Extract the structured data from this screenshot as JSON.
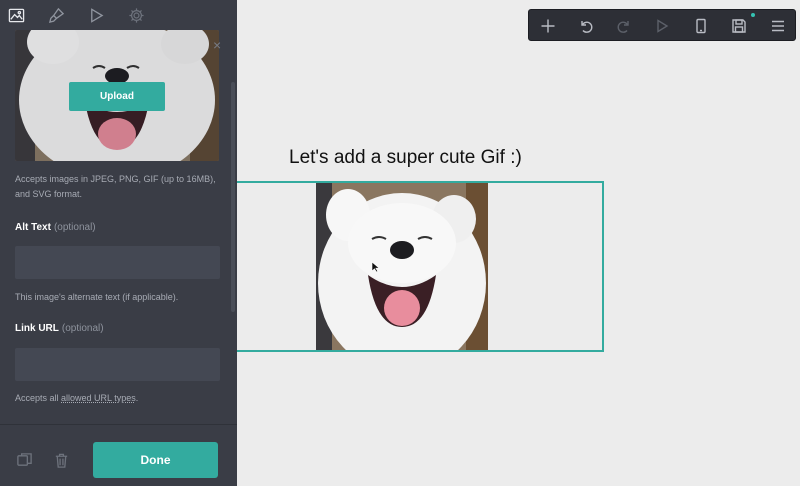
{
  "sidebar": {
    "tabs": [
      {
        "name": "image",
        "icon": "image-icon"
      },
      {
        "name": "style",
        "icon": "brush-icon"
      },
      {
        "name": "animation",
        "icon": "play-icon"
      },
      {
        "name": "settings",
        "icon": "gear-icon"
      }
    ],
    "upload_label": "Upload",
    "accepts_help": "Accepts images in JPEG, PNG, GIF (up to 16MB), and SVG format.",
    "alt_text": {
      "label": "Alt Text",
      "optional": "(optional)",
      "value": "",
      "help": "This image's alternate text (if applicable)."
    },
    "link_url": {
      "label": "Link URL",
      "optional": "(optional)",
      "value": "",
      "help_prefix": "Accepts all ",
      "help_link": "allowed URL types",
      "help_suffix": "."
    },
    "done_label": "Done"
  },
  "toolbar": {
    "buttons": [
      "add-icon",
      "undo-icon",
      "redo-icon",
      "preview-icon",
      "mobile-icon",
      "save-icon",
      "menu-icon"
    ],
    "save_indicator_color": "#35c2b2"
  },
  "canvas": {
    "heading": "Let's add a super cute Gif :)"
  },
  "colors": {
    "accent": "#33ab9f",
    "sidebar_bg": "#3a3d46",
    "canvas_bg": "#ececec"
  }
}
